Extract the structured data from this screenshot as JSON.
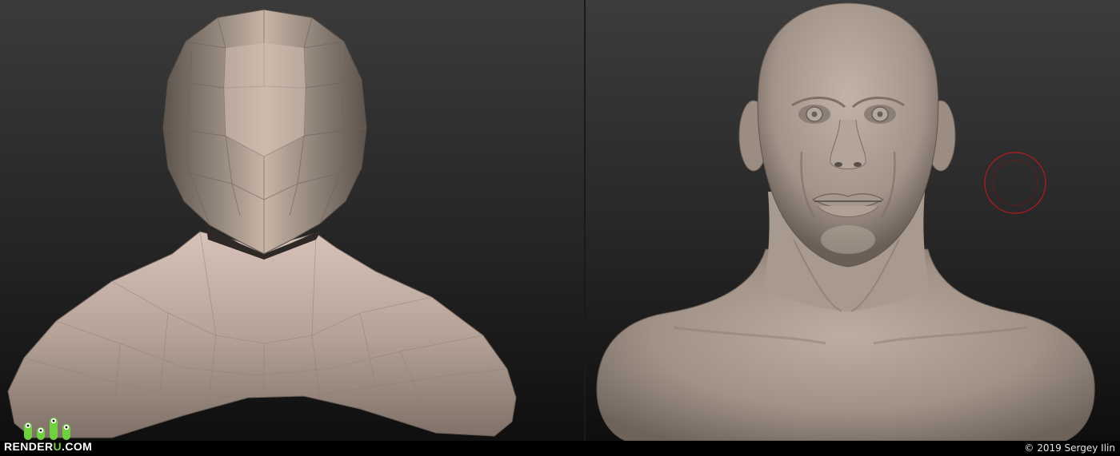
{
  "branding": {
    "logo_text_main": "RENDER",
    "logo_text_accent": "U",
    "logo_text_suffix": ".COM"
  },
  "footer": {
    "copyright": "© 2019 Sergey Ilin"
  },
  "viewports": {
    "left": {
      "model": "low-poly-bust-base-mesh"
    },
    "right": {
      "model": "sculpted-head-bust"
    }
  },
  "brush_cursor": {
    "color": "#c0181e"
  },
  "colors": {
    "clay": "#a5978b",
    "clay_light": "#d2bfb6",
    "clay_dark": "#5f554d",
    "background_top": "#3a3a3a",
    "background_bottom": "#0e0e0e",
    "logo_accent": "#6fd13c"
  }
}
